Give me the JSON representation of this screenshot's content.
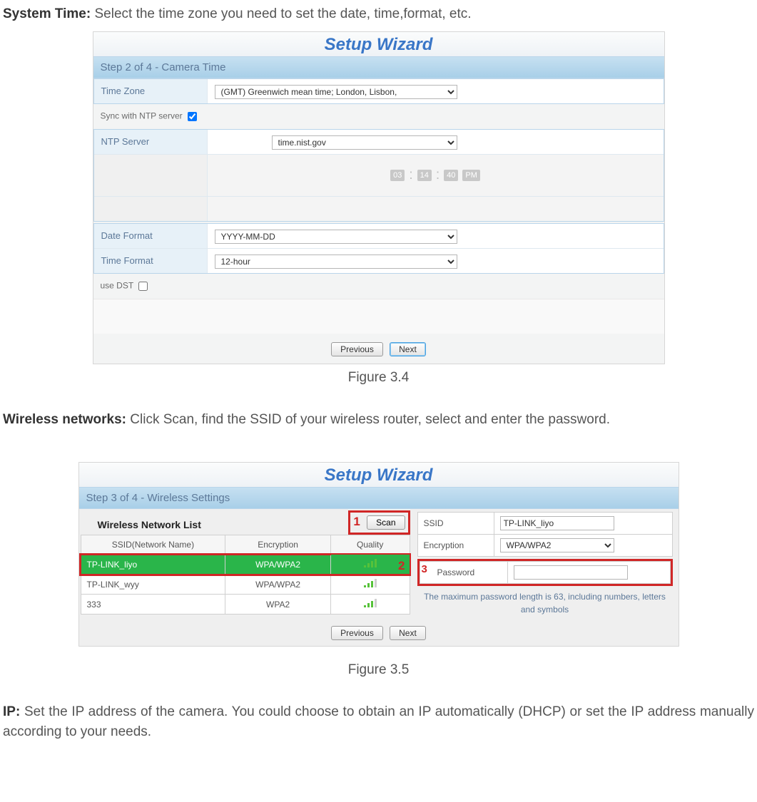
{
  "intro1": {
    "lead": "System Time:",
    "text": " Select the time zone you need to set the date, time,format, etc."
  },
  "wiz_title": "Setup Wizard",
  "fig34": {
    "step": "Step 2 of 4 - Camera Time",
    "tz_label": "Time Zone",
    "tz_value": "(GMT) Greenwich mean time; London, Lisbon,",
    "ntp_sync_label": "Sync with NTP server",
    "ntp_label": "NTP Server",
    "ntp_value": "time.nist.gov",
    "ghost": {
      "a": "03",
      "b": "14",
      "c": "40",
      "d": "PM"
    },
    "datefmt_label": "Date Format",
    "datefmt_value": "YYYY-MM-DD",
    "timefmt_label": "Time Format",
    "timefmt_value": "12-hour",
    "dst_label": "use DST",
    "prev": "Previous",
    "next": "Next",
    "caption": "Figure 3.4"
  },
  "intro2": {
    "lead": "Wireless networks:",
    "text": " Click Scan, find the SSID of your wireless router, select and enter the password."
  },
  "fig35": {
    "step": "Step 3 of 4 - Wireless Settings",
    "list_title": "Wireless Network List",
    "scan": "Scan",
    "marker1": "1",
    "marker2": "2",
    "marker3": "3",
    "headers": {
      "ssid": "SSID(Network Name)",
      "enc": "Encryption",
      "q": "Quality"
    },
    "rows": [
      {
        "ssid": "TP-LINK_liyo",
        "enc": "WPA/WPA2",
        "selected": true
      },
      {
        "ssid": "TP-LINK_wyy",
        "enc": "WPA/WPA2",
        "selected": false
      },
      {
        "ssid": "333",
        "enc": "WPA2",
        "selected": false
      }
    ],
    "right": {
      "ssid_label": "SSID",
      "ssid_value": "TP-LINK_liyo",
      "enc_label": "Encryption",
      "enc_value": "WPA/WPA2",
      "pw_label": "Password",
      "hint": "The maximum password length is 63, including numbers, letters and symbols"
    },
    "prev": "Previous",
    "next": "Next",
    "caption": "Figure 3.5"
  },
  "intro3": {
    "lead": "IP:",
    "text": " Set the IP address of the camera. You could choose to obtain an IP automatically (DHCP) or set the IP address manually according to your needs."
  }
}
